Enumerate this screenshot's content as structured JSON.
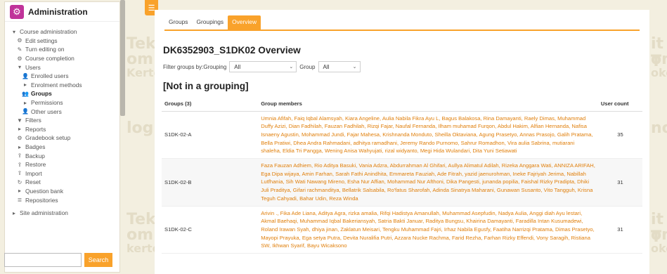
{
  "watermarks": [
    "Tekn",
    "om",
    "Kerto",
    "logi",
    "Tekn",
    "om",
    "kerto",
    "it T",
    "om",
    "okerl",
    "nolog",
    "it T",
    "om",
    "okerl"
  ],
  "block": {
    "title": "Administration",
    "items": [
      {
        "label": "Course administration",
        "icon": "caret-down-icon",
        "level": 0
      },
      {
        "label": "Edit settings",
        "icon": "gear-icon",
        "level": 1
      },
      {
        "label": "Turn editing on",
        "icon": "pencil-icon",
        "level": 1
      },
      {
        "label": "Course completion",
        "icon": "gear-icon",
        "level": 1
      },
      {
        "label": "Users",
        "icon": "caret-down-icon",
        "level": 1
      },
      {
        "label": "Enrolled users",
        "icon": "user-icon",
        "level": 2
      },
      {
        "label": "Enrolment methods",
        "icon": "caret-right-icon",
        "level": 2
      },
      {
        "label": "Groups",
        "icon": "users-icon",
        "level": 2,
        "active": true
      },
      {
        "label": "Permissions",
        "icon": "caret-right-icon",
        "level": 2
      },
      {
        "label": "Other users",
        "icon": "user-icon",
        "level": 2
      },
      {
        "label": "Filters",
        "icon": "filter-icon",
        "level": 1
      },
      {
        "label": "Reports",
        "icon": "caret-right-icon",
        "level": 1
      },
      {
        "label": "Gradebook setup",
        "icon": "gear-icon",
        "level": 1
      },
      {
        "label": "Badges",
        "icon": "caret-right-icon",
        "level": 1
      },
      {
        "label": "Backup",
        "icon": "backup-icon",
        "level": 1
      },
      {
        "label": "Restore",
        "icon": "restore-icon",
        "level": 1
      },
      {
        "label": "Import",
        "icon": "import-icon",
        "level": 1
      },
      {
        "label": "Reset",
        "icon": "reset-icon",
        "level": 1
      },
      {
        "label": "Question bank",
        "icon": "caret-right-icon",
        "level": 1
      },
      {
        "label": "Repositories",
        "icon": "repository-icon",
        "level": 1
      },
      {
        "label": "Site administration",
        "icon": "caret-right-icon",
        "level": 0,
        "gap": true
      }
    ],
    "search_placeholder": "",
    "search_label": "Search"
  },
  "tabs": [
    {
      "label": "Groups",
      "selected": false
    },
    {
      "label": "Groupings",
      "selected": false
    },
    {
      "label": "Overview",
      "selected": true
    }
  ],
  "page_title": "DK6352903_S1DK02 Overview",
  "filters": {
    "grouping_label": "Filter groups by:Grouping",
    "grouping_value": "All",
    "group_label": "Group",
    "group_value": "All"
  },
  "section_heading": "[Not in a grouping]",
  "table": {
    "headers": {
      "groups": "Groups (3)",
      "members": "Group members",
      "count": "User count"
    },
    "rows": [
      {
        "name": "S1DK-02-A",
        "members": "Umnia Afifah, Faiq Iqbal Alamsyah, Kiara Angeline, Aulia Nabila Fikra Ayu L, Bagus Balakosa, Rina Damayanti, Raely Dimas, Muhammad Duffy Azizi, Dian Fadhilah, Fauzan Fadhilah, Rizqi Fajar, Naufal Fernanda, Ilham muhamad Furqon, Abdul Hakim, Alfian Hernanda, Nafisa Isnaeny Agustin, Mohammad Jundi, Fajar Mahesa, Krishnanda Monduto, Sheilla Oktaviana, Agung Prasetyo, Annas Prasojo, Galih Pratama, Bella Pratiwi, Dhea Andra Rahmadani, adhitya ramadhani, Jeremy Rando Purnomo, Sahrur Romadhon, Vira aulia Sabrina, mutiarani shaleha, Eldia Tri Pangga, Wening Anisa Wahyujati, rizal widyanto, Megi Hida Wulandari, Dita Yuni Setiawati",
        "count": "35"
      },
      {
        "name": "S1DK-02-B",
        "members": "Faza Fauzan Adhiem, Rio Aditya Basuki, Vania Adzra, Abdurrahman Al Ghifari, Aullya Alimatul Adilah, Rizeka Anggara Wati, ANNIZA ARIFAH, Ega Dipa wijaya, Amin Farhan, Sarah Fathi Anindhita, Emmareta Fauziah, Ade Fitrah, yazid jaenurohman, Ineke Fajriyah Jerima, Nabillah Lutfhania, Sih Wati Nawang Mireno, Esha Nur Affian, Mohammad Nur Afthoni, Dika Pangesti, junanda popilia, Faishal Rizky Pradipta, Dhiki Juli Praditya, Gifari rachmanditya, Bellatrik Salsabila, Ro'fatus Sharofah, Adinda Sinatrya Maharani, Gunawan Susanto, Vito Tangguh, Krisna Teguh Cahyadi, Bahar Udin, Reza Winda",
        "count": "31"
      },
      {
        "name": "S1DK-02-C",
        "members": "Arivin ., Fika Ade Liana, Aditya Agra, rizka amalia, Rifqi Hadistya Amanullah, Muhammad Asepfudin, Nadya Aulia, Anggi diah Ayu lestari, Akmal Baehaqi, Muhammad Iqbal Bakeriansyah, Satria Bakti Januar, Raditya Bungsu, Khairina Damayanti, Faradilla Intan Kusumadewi, Roland Irawan Syah, dhiya jinan, Zaklatun Meisari, Tengku Muhammad Fajri, Irhaz Nabila Egusfy, Faatiha Narrizqi Pratama, Dimas Prasetyo, Mayopi Prayuka, Ega setya Putra, Devita Nuralifia Putri, Azzara Nucke Rachma, Farid Rezha, Farhan Rizky Effendi, Vony Saragih, Ristiana SW, Ikhwan Syarif, Bayu Wicaksono",
        "count": "31"
      }
    ]
  }
}
